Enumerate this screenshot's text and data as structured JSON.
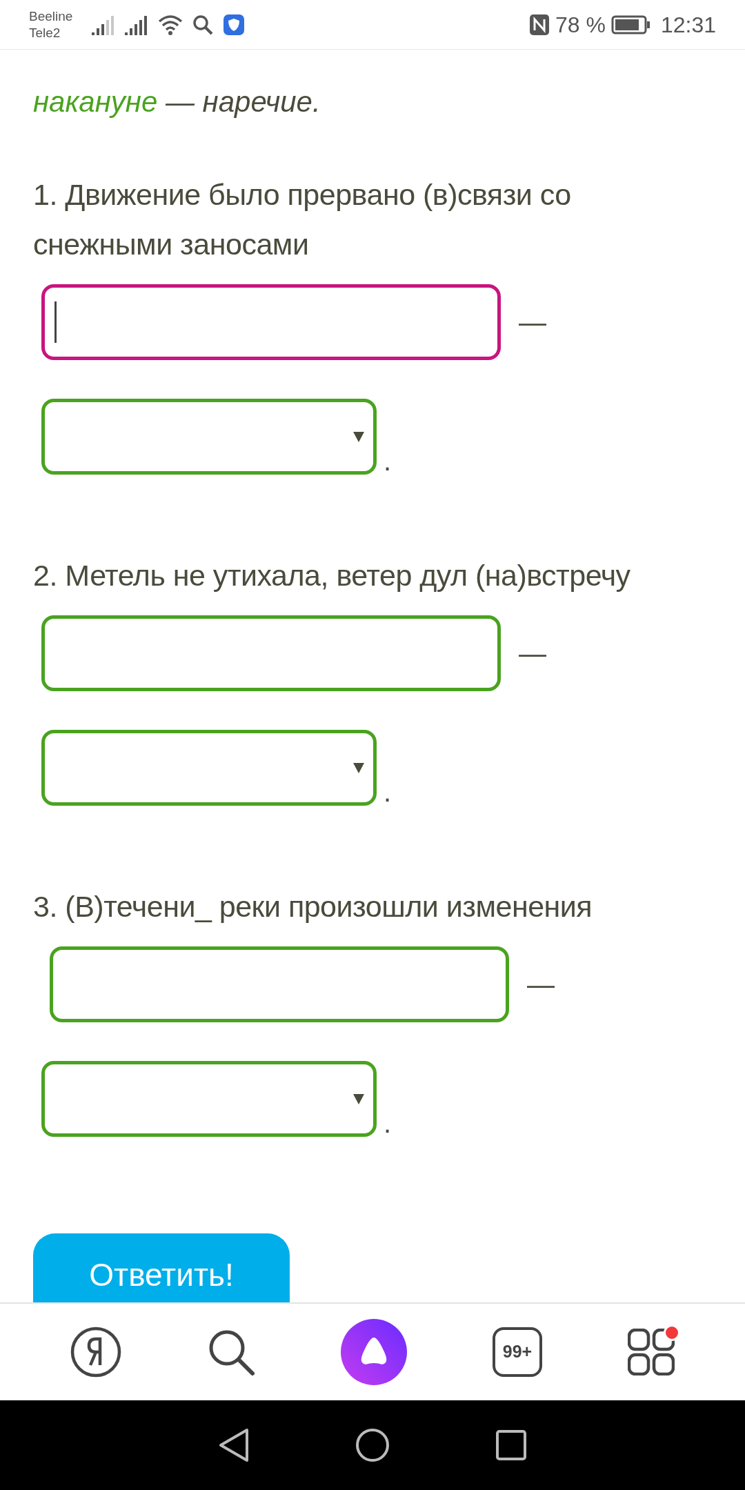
{
  "status_bar": {
    "carriers": [
      "Beeline",
      "Tele2"
    ],
    "battery": "78 %",
    "time": "12:31"
  },
  "intro": {
    "answer": "накануне",
    "explanation": "— наречие."
  },
  "questions": [
    {
      "number": "1.",
      "text": "Движение было прервано (в)связи со снежными заносами",
      "input": {
        "focused": true
      },
      "dash": "—",
      "period": "."
    },
    {
      "number": "2.",
      "text": "Метель не утихала, ветер дул (на)встречу",
      "input": {
        "focused": false
      },
      "dash": "—",
      "period": "."
    },
    {
      "number": "3.",
      "text": "(В)течени_ реки произошли изменения",
      "input": {
        "focused": false
      },
      "dash": "—",
      "period": "."
    }
  ],
  "submit_button": "Ответить!",
  "nav_bar": [
    {
      "kind": "yandex"
    },
    {
      "kind": "search"
    },
    {
      "kind": "alice"
    },
    {
      "kind": "tabs",
      "badge": "99+"
    },
    {
      "kind": "apps",
      "has_notification": true
    }
  ]
}
